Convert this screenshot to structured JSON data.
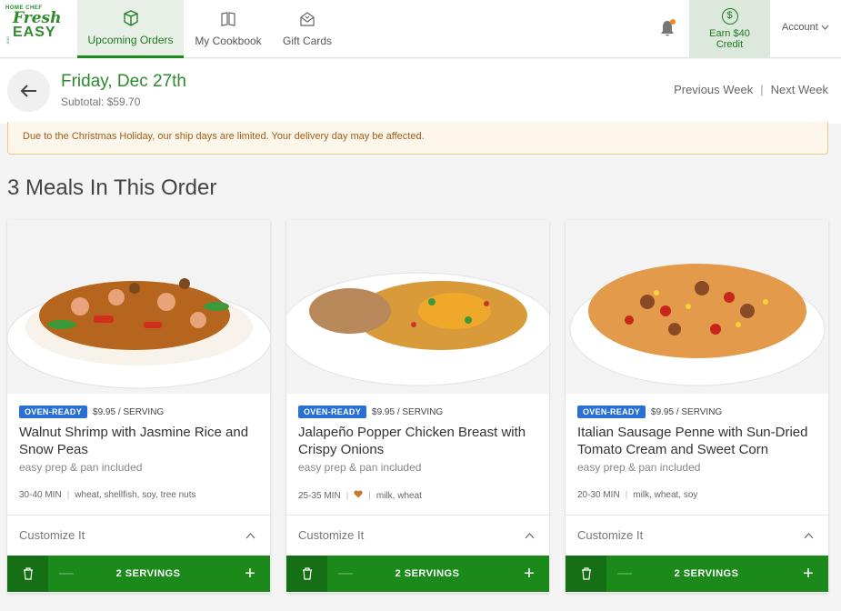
{
  "brand": {
    "line1": "HOME CHEF",
    "line2": "Fresh",
    "line3": "EASY",
    "line_and": "AND"
  },
  "nav": {
    "tabs": [
      {
        "label": "Upcoming Orders",
        "icon": "box-icon",
        "active": true
      },
      {
        "label": "My Cookbook",
        "icon": "book-icon",
        "active": false
      },
      {
        "label": "Gift Cards",
        "icon": "gift-envelope-icon",
        "active": false
      }
    ],
    "earn": {
      "symbol": "$",
      "line1": "Earn $40",
      "line2": "Credit"
    },
    "account_label": "Account"
  },
  "order": {
    "date": "Friday, Dec 27th",
    "subtotal": "Subtotal: $59.70",
    "prev_week": "Previous Week",
    "separator": "|",
    "next_week": "Next Week"
  },
  "notice": "Due to the Christmas Holiday, our ship days are limited. Your delivery day may be affected.",
  "section_title": "3 Meals In This Order",
  "meals": [
    {
      "badge": "OVEN-READY",
      "price": "$9.95 / SERVING",
      "title": "Walnut Shrimp with Jasmine Rice and Snow Peas",
      "subtitle": "easy prep & pan included",
      "time": "30-40 MIN",
      "allergens": "wheat, shellfish, soy, tree nuts",
      "customize": "Customize It",
      "servings": "2 SERVINGS"
    },
    {
      "badge": "OVEN-READY",
      "price": "$9.95 / SERVING",
      "title": "Jalapeño Popper Chicken Breast with Crispy Onions",
      "subtitle": "easy prep & pan included",
      "time": "25-35 MIN",
      "allergens": "milk, wheat",
      "customize": "Customize It",
      "servings": "2 SERVINGS"
    },
    {
      "badge": "OVEN-READY",
      "price": "$9.95 / SERVING",
      "title": "Italian Sausage Penne with Sun-Dried Tomato Cream and Sweet Corn",
      "subtitle": "easy prep & pan included",
      "time": "20-30 MIN",
      "allergens": "milk, wheat, soy",
      "customize": "Customize It",
      "servings": "2 SERVINGS"
    }
  ],
  "colors": {
    "brand_green": "#1b8a1b",
    "badge_blue": "#2a6fd6",
    "notice_text": "#a35d1a",
    "notification_dot": "#f08a1c"
  }
}
